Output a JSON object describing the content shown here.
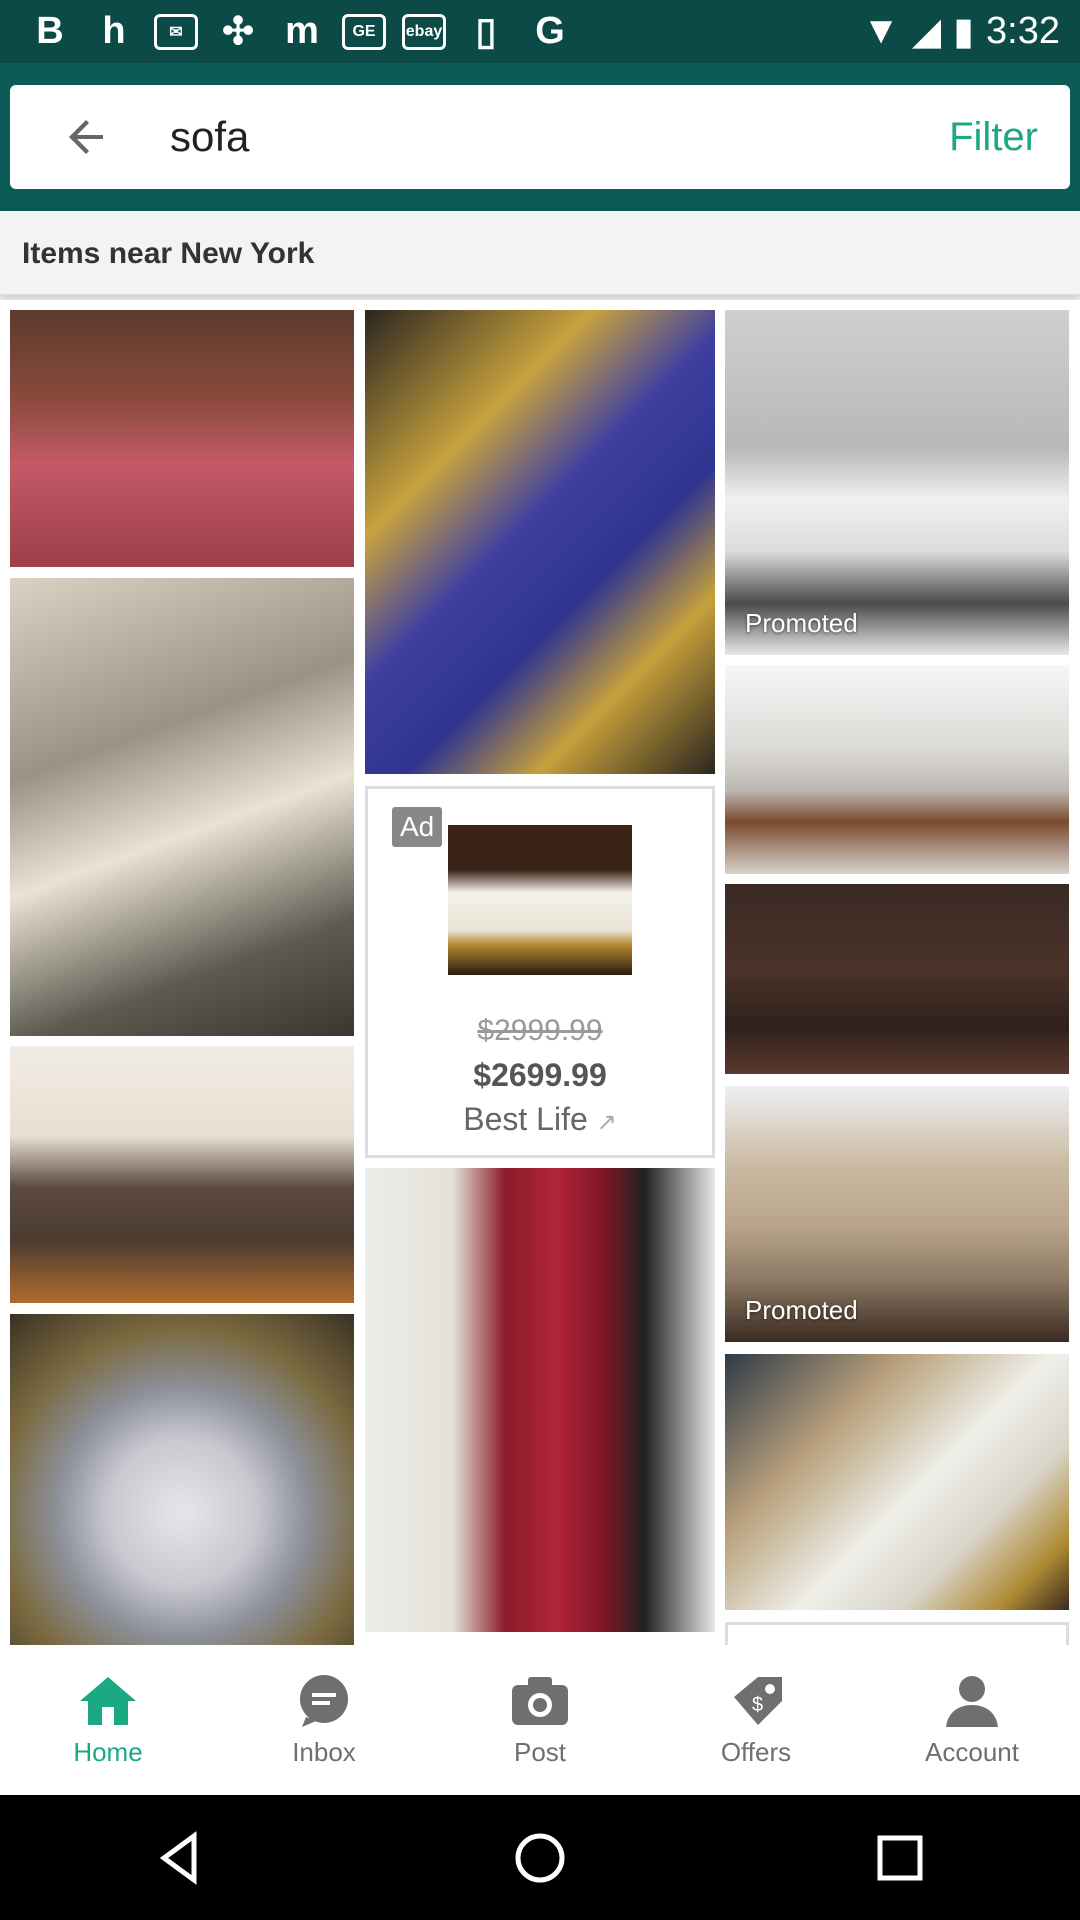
{
  "status_bar": {
    "time": "3:32",
    "left_icons": [
      "B",
      "h",
      "mail",
      "cross",
      "m",
      "ge",
      "ebay",
      "phone",
      "G"
    ],
    "right_icons": [
      "wifi-icon",
      "signal-icon",
      "battery-icon"
    ]
  },
  "search": {
    "query": "sofa",
    "filter_label": "Filter"
  },
  "section": {
    "title": "Items near New York"
  },
  "grid": {
    "promoted_label_1": "Promoted",
    "promoted_label_2": "Promoted",
    "ad": {
      "badge": "Ad",
      "old_price": "$2999.99",
      "price": "$2699.99",
      "seller": "Best Life"
    }
  },
  "bottom_nav": {
    "items": [
      {
        "label": "Home",
        "icon": "home-icon",
        "active": true
      },
      {
        "label": "Inbox",
        "icon": "chat-icon",
        "active": false
      },
      {
        "label": "Post",
        "icon": "camera-icon",
        "active": false
      },
      {
        "label": "Offers",
        "icon": "tag-icon",
        "active": false
      },
      {
        "label": "Account",
        "icon": "account-icon",
        "active": false
      }
    ]
  },
  "colors": {
    "accent": "#1ca883",
    "header": "#0b5a55",
    "status_bar": "#0b4a46"
  }
}
